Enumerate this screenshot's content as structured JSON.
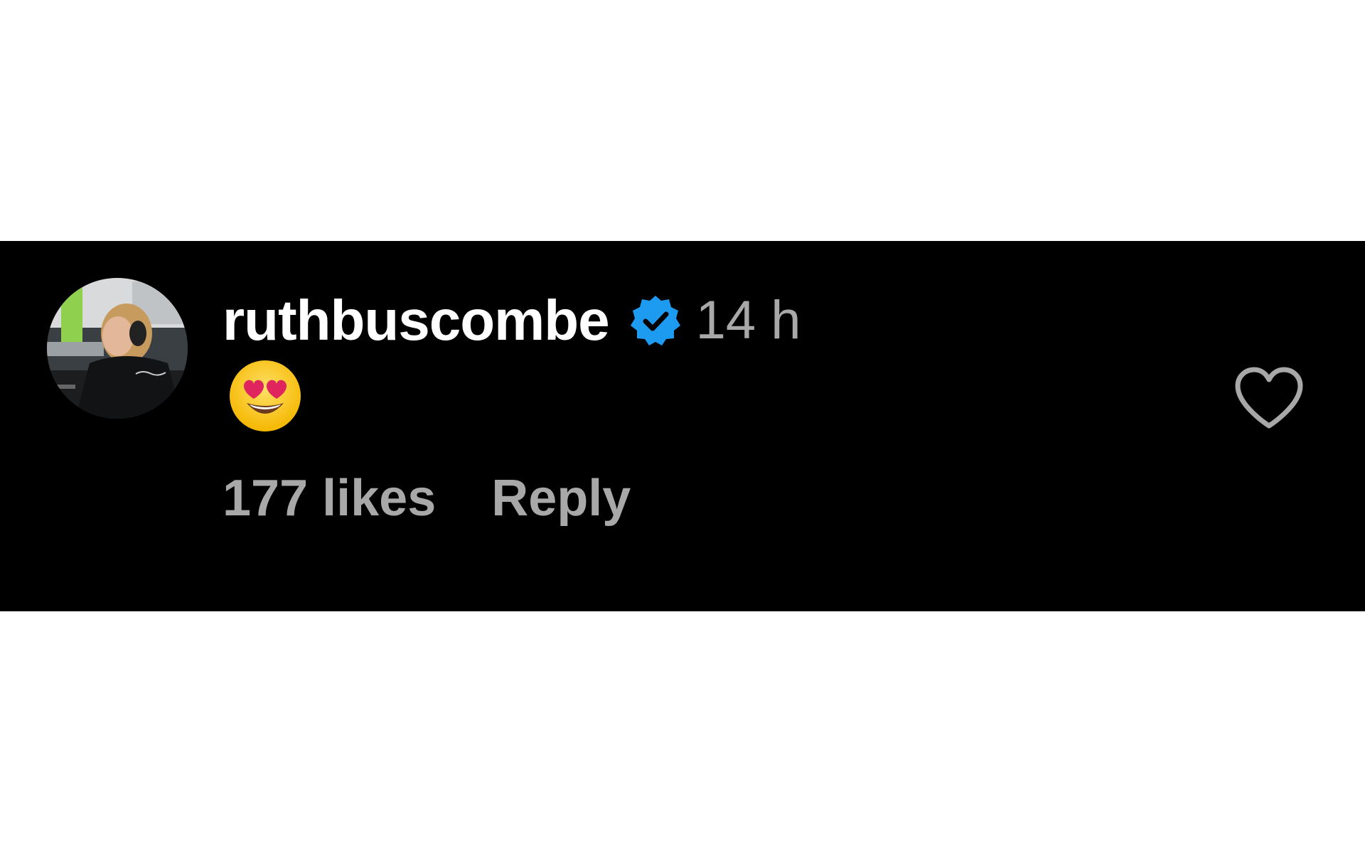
{
  "comment": {
    "username": "ruthbuscombe",
    "verified": true,
    "timestamp": "14 h",
    "body_emoji": "smiling-face-with-heart-eyes",
    "likes_label": "177 likes",
    "reply_label": "Reply"
  },
  "icons": {
    "verified": "verified-badge-icon",
    "like": "heart-outline-icon"
  },
  "colors": {
    "background": "#000000",
    "username": "#ffffff",
    "secondary_text": "#a8a8a8",
    "verified_badge": "#1d9bf0"
  }
}
